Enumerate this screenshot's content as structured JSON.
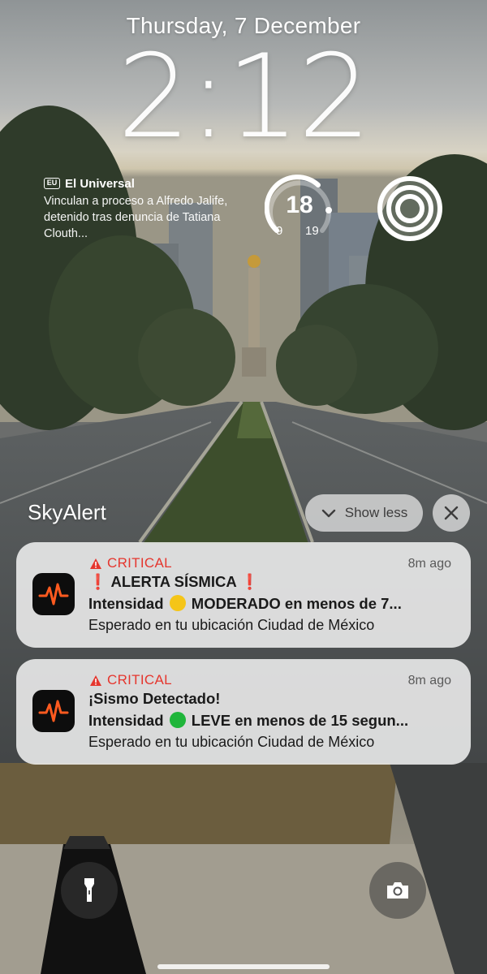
{
  "lockscreen": {
    "date": "Thursday, 7 December",
    "time": "2:12"
  },
  "news_widget": {
    "logo": "EU",
    "source": "El Universal",
    "headline": "Vinculan a proceso a Alfredo Jalife, detenido tras denuncia de Tatiana Clouth..."
  },
  "temp_widget": {
    "current": "18",
    "low": "9",
    "high": "19"
  },
  "rings_widget": {
    "icon": "concentric-rings-icon"
  },
  "notification_group": {
    "app_name": "SkyAlert",
    "show_less_label": "Show less",
    "close_icon": "close-icon"
  },
  "notifications": [
    {
      "level": "CRITICAL",
      "time_ago": "8m ago",
      "title_prefix": "❗",
      "title": "ALERTA SÍSMICA",
      "title_suffix": "❗",
      "subtitle_pre": "Intensidad",
      "dot_color": "#f5c518",
      "subtitle_post": "MODERADO en menos de 7...",
      "body": "Esperado en tu ubicación Ciudad de México"
    },
    {
      "level": "CRITICAL",
      "time_ago": "8m ago",
      "title": "¡Sismo Detectado!",
      "subtitle_pre": "Intensidad",
      "dot_color": "#1fb53a",
      "subtitle_post": "LEVE en menos de 15 segun...",
      "body": "Esperado en tu ubicación Ciudad de México"
    }
  ],
  "quick_actions": {
    "flashlight_icon": "flashlight-icon",
    "camera_icon": "camera-icon"
  },
  "colors": {
    "critical_red": "#e5362e",
    "app_icon_bg": "#0d0d0d",
    "app_icon_wave": "#ff5a1f"
  }
}
